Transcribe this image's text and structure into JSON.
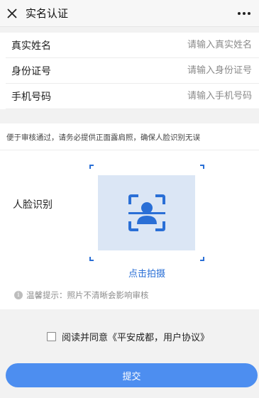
{
  "titlebar": {
    "title": "实名认证",
    "close_icon": "close-icon",
    "more_icon": "more-dots-icon"
  },
  "form": {
    "fields": [
      {
        "label": "真实姓名",
        "placeholder": "请输入真实姓名",
        "value": ""
      },
      {
        "label": "身份证号",
        "placeholder": "请输入身份证号",
        "value": ""
      },
      {
        "label": "手机号码",
        "placeholder": "请输入手机号码",
        "value": ""
      }
    ]
  },
  "notice": "便于审核通过，请务必提供正面露肩照，确保人脸识别无误",
  "face": {
    "label": "人脸识别",
    "capture_label": "点击拍摄",
    "tip": "温馨提示：照片不清晰会影响审核",
    "accent_color": "#2a6fd6",
    "placeholder_icon": "face-scan-icon"
  },
  "agreement": {
    "checked": false,
    "text": "阅读并同意《平安成都，用户协议》"
  },
  "submit": {
    "label": "提交",
    "color": "#4d8ef0"
  }
}
